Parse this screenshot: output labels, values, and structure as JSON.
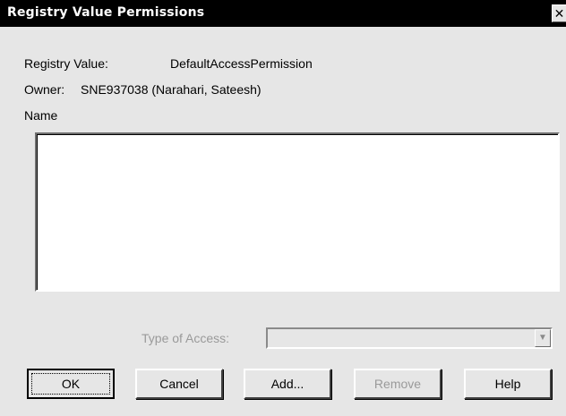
{
  "dialog": {
    "title": "Registry Value Permissions",
    "close_glyph": "✕"
  },
  "info": {
    "value_label": "Registry Value:",
    "value": "DefaultAccessPermission",
    "owner_label": "Owner:",
    "owner_value": "SNE937038 (Narahari, Sateesh)"
  },
  "names": {
    "label": "Name",
    "items": []
  },
  "access": {
    "label": "Type of Access:",
    "selected": ""
  },
  "buttons": {
    "ok": "OK",
    "cancel": "Cancel",
    "add": "Add...",
    "remove": "Remove",
    "help": "Help"
  }
}
